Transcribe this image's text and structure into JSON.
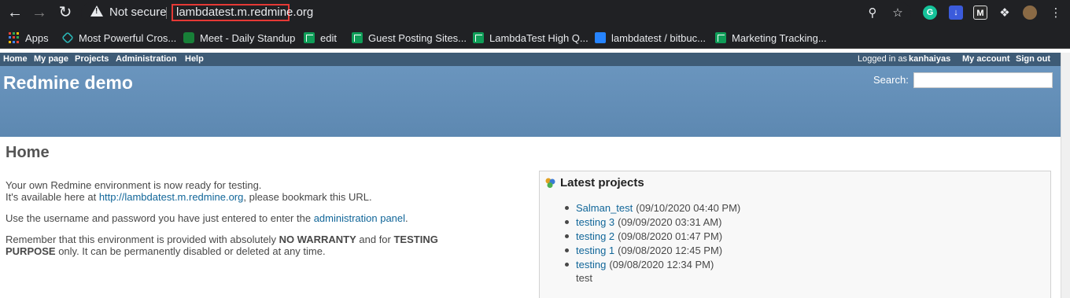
{
  "browser": {
    "security_label": "Not secure",
    "url": "lambdatest.m.redmine.org",
    "bookmarks": [
      {
        "label": "Apps",
        "icon": "apps-grid-icon"
      },
      {
        "label": "Most Powerful Cros...",
        "icon": "lambdatest-icon"
      },
      {
        "label": "Meet - Daily Standup",
        "icon": "google-meet-icon"
      },
      {
        "label": "edit",
        "icon": "sheets-icon"
      },
      {
        "label": "Guest Posting Sites...",
        "icon": "sheets-icon"
      },
      {
        "label": "LambdaTest High Q...",
        "icon": "sheets-icon"
      },
      {
        "label": "lambdatest / bitbuc...",
        "icon": "bitbucket-icon"
      },
      {
        "label": "Marketing Tracking...",
        "icon": "sheets-icon"
      }
    ]
  },
  "top_menu": {
    "items": [
      "Home",
      "My page",
      "Projects",
      "Administration",
      "Help"
    ],
    "logged_in_as": "Logged in as",
    "username": "kanhaiyas",
    "my_account": "My account",
    "sign_out": "Sign out"
  },
  "header": {
    "title": "Redmine demo",
    "search_label": "Search:"
  },
  "main": {
    "title": "Home",
    "intro_line1": "Your own Redmine environment is now ready for testing.",
    "intro_line2_prefix": "It's available here at ",
    "intro_link": "http://lambdatest.m.redmine.org",
    "intro_line2_suffix": ", please bookmark this URL.",
    "usage_prefix": "Use the username and password you have just entered to enter the ",
    "admin_link": "administration panel",
    "usage_suffix": ".",
    "warning_prefix": "Remember that this environment is provided with absolutely ",
    "no_warranty": "NO WARRANTY",
    "warning_mid": " and for ",
    "testing": "TESTING",
    "purpose": "PURPOSE",
    "warning_suffix": " only. It can be permanently disabled or deleted at any time."
  },
  "latest_projects": {
    "title": "Latest projects",
    "items": [
      {
        "name": "Salman_test",
        "date": "(09/10/2020 04:40 PM)"
      },
      {
        "name": "testing 3",
        "date": "(09/09/2020 03:31 AM)"
      },
      {
        "name": "testing 2",
        "date": "(09/08/2020 01:47 PM)"
      },
      {
        "name": "testing 1",
        "date": "(09/08/2020 12:45 PM)"
      },
      {
        "name": "testing",
        "date": "(09/08/2020 12:34 PM)"
      }
    ],
    "last_description": "test"
  },
  "colors": {
    "header_blue": "#628db6",
    "top_menu": "#3e5b76",
    "link": "#116699"
  }
}
